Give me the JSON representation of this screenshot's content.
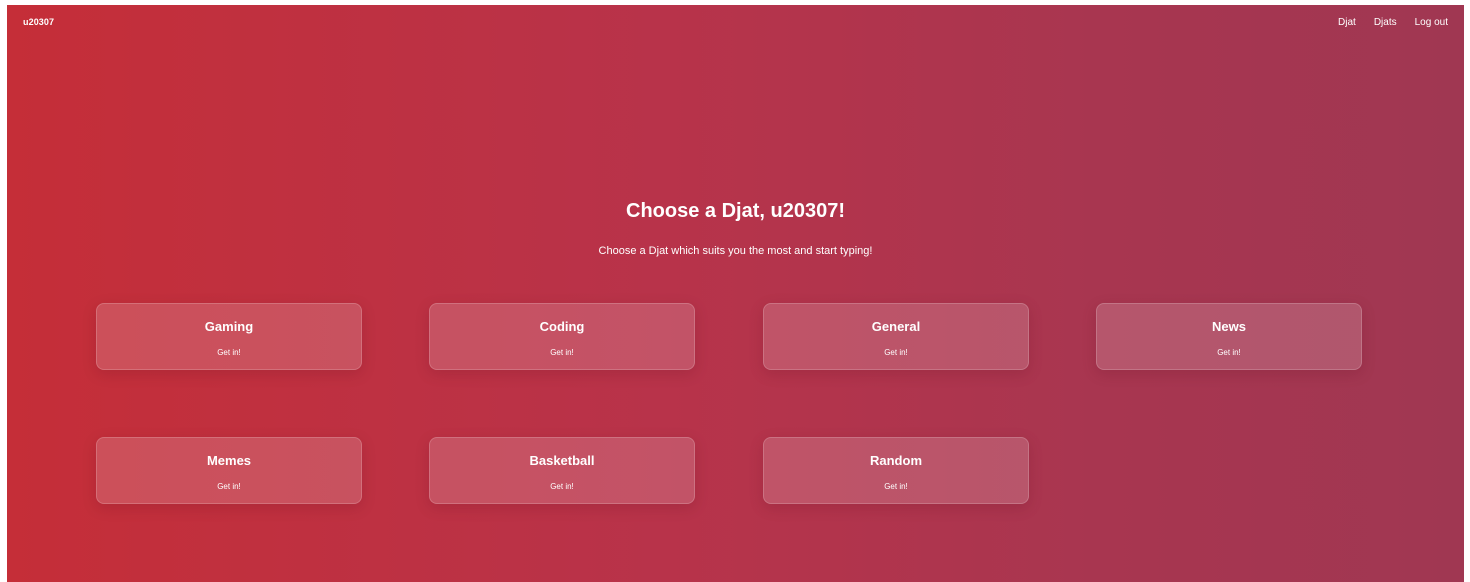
{
  "nav": {
    "brand": "u20307",
    "links": [
      "Djat",
      "Djats",
      "Log out"
    ]
  },
  "hero": {
    "title": "Choose a Djat, u20307!",
    "subtitle": "Choose a Djat which suits you the most and start typing!"
  },
  "cards": [
    {
      "title": "Gaming",
      "cta": "Get in!"
    },
    {
      "title": "Coding",
      "cta": "Get in!"
    },
    {
      "title": "General",
      "cta": "Get in!"
    },
    {
      "title": "News",
      "cta": "Get in!"
    },
    {
      "title": "Memes",
      "cta": "Get in!"
    },
    {
      "title": "Basketball",
      "cta": "Get in!"
    },
    {
      "title": "Random",
      "cta": "Get in!"
    }
  ],
  "colors": {
    "gradient_start": "#c52e38",
    "gradient_end": "#a03752",
    "text": "#ffffff"
  }
}
